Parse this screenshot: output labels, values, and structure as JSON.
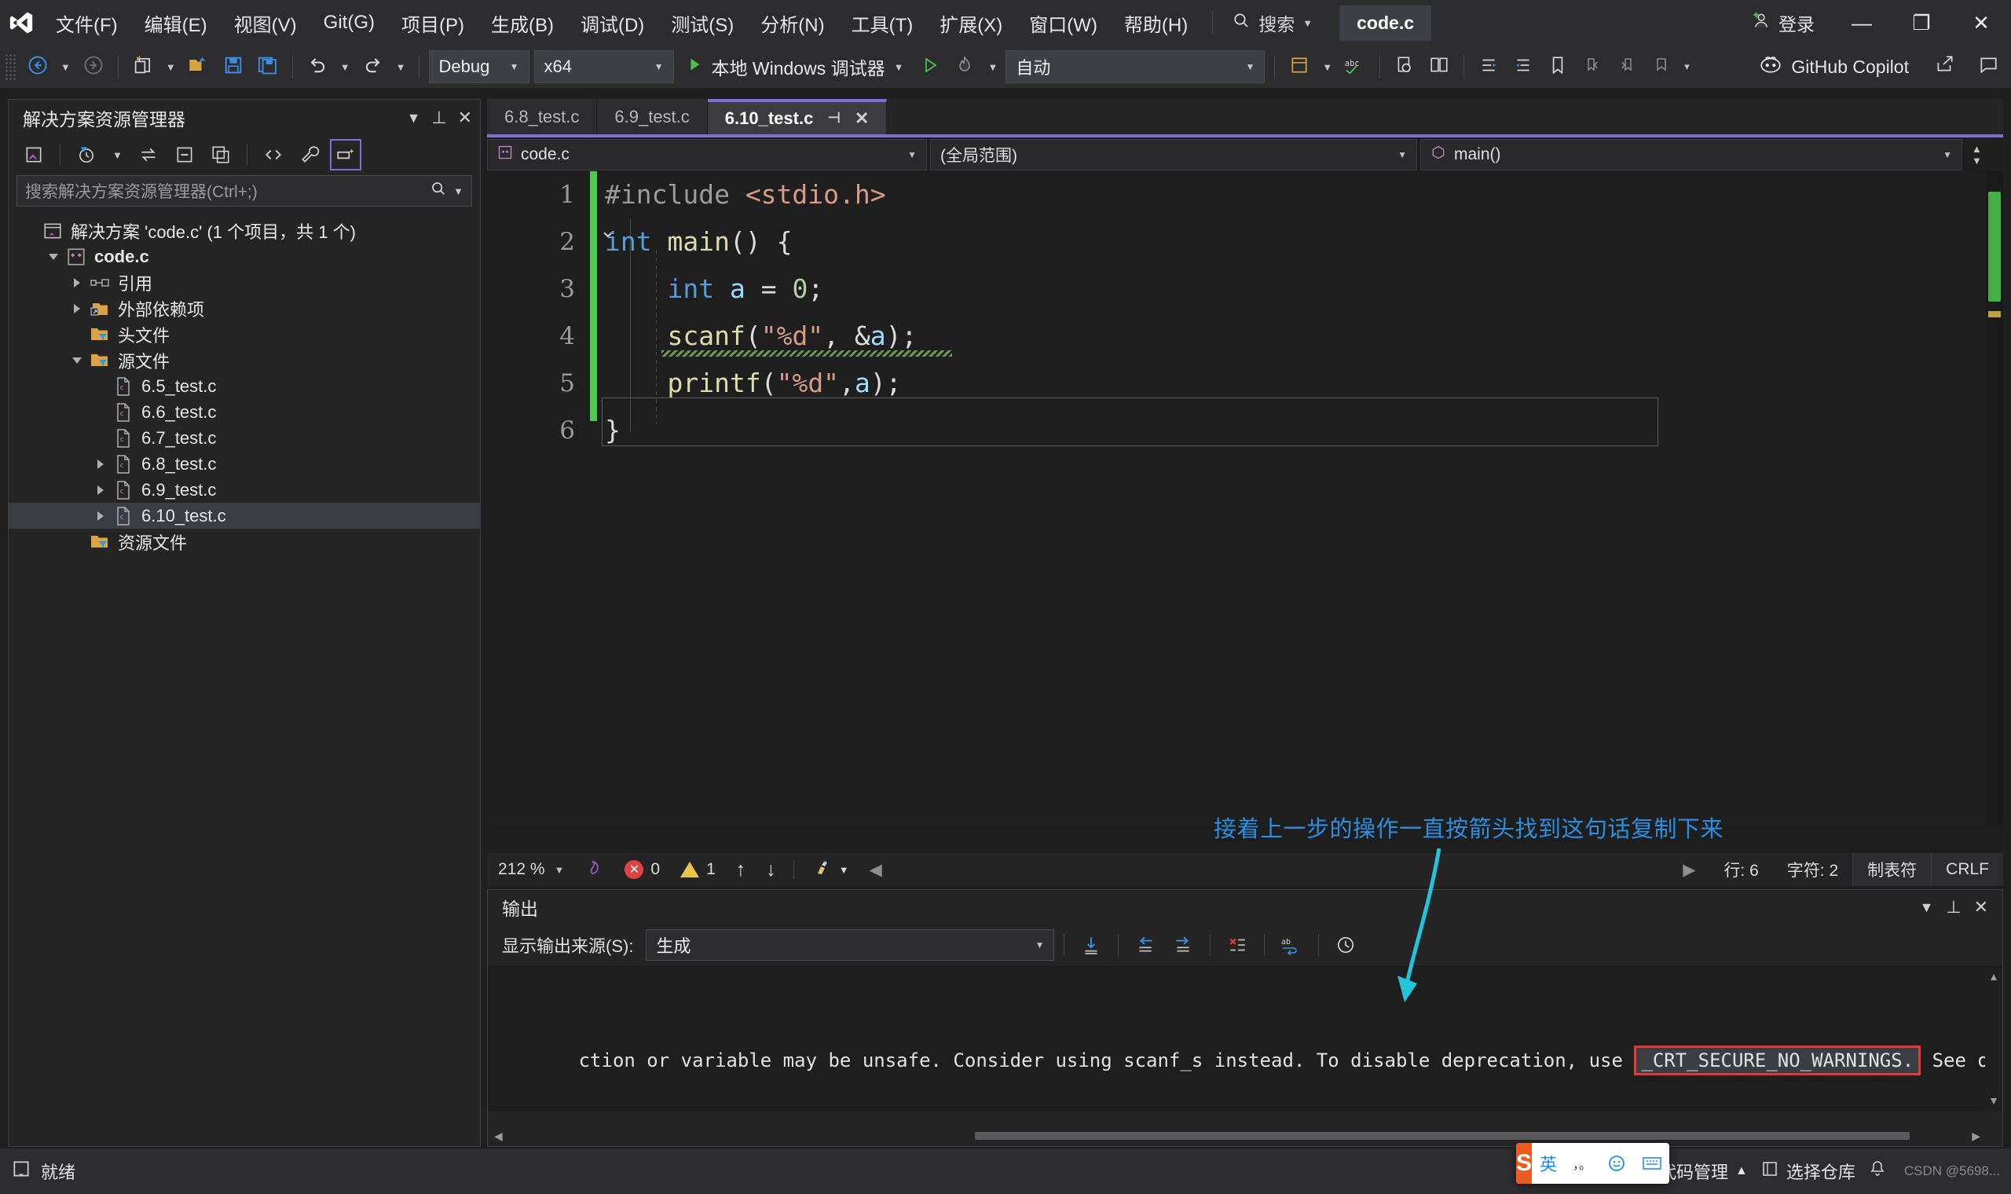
{
  "titlebar": {
    "logo_icon": "visual-studio-logo-icon",
    "menus": [
      {
        "label": "文件(F)"
      },
      {
        "label": "编辑(E)"
      },
      {
        "label": "视图(V)"
      },
      {
        "label": "Git(G)"
      },
      {
        "label": "项目(P)"
      },
      {
        "label": "生成(B)"
      },
      {
        "label": "调试(D)"
      },
      {
        "label": "测试(S)"
      },
      {
        "label": "分析(N)"
      },
      {
        "label": "工具(T)"
      },
      {
        "label": "扩展(X)"
      },
      {
        "label": "窗口(W)"
      },
      {
        "label": "帮助(H)"
      }
    ],
    "search_label": "搜索",
    "document_title": "code.c",
    "signin_label": "登录",
    "minimize_glyph": "—",
    "maximize_glyph": "❐",
    "close_glyph": "✕"
  },
  "toolbar": {
    "back_icon": "navigate-back-icon",
    "forward_icon": "navigate-forward-icon",
    "new_project_icon": "new-project-icon",
    "open_icon": "open-folder-icon",
    "save_icon": "save-icon",
    "save_all_icon": "save-all-icon",
    "undo_icon": "undo-icon",
    "redo_icon": "redo-icon",
    "config_value": "Debug",
    "platform_value": "x64",
    "run_label": "本地 Windows 调试器",
    "run_icon": "play-green-icon",
    "start_no_debug_icon": "play-outline-icon",
    "hot_reload_icon": "hot-reload-icon",
    "auto_value": "自动",
    "copilot_label": "GitHub Copilot",
    "copilot_icon": "copilot-icon",
    "share_icon": "share-icon",
    "feedback_icon": "feedback-icon"
  },
  "solution_explorer": {
    "title": "解决方案资源管理器",
    "header_icons": [
      "chevron-down-icon",
      "pin-icon",
      "close-icon"
    ],
    "toolbar_icons": [
      "solution-home-icon",
      "pending-changes-filter-icon",
      "sync-with-active-document-icon",
      "collapse-all-icon",
      "show-all-files-icon",
      "view-code-icon",
      "properties-wrench-icon",
      "toggle-preview-icon"
    ],
    "search_placeholder": "搜索解决方案资源管理器(Ctrl+;)",
    "tree": [
      {
        "label": "解决方案 'code.c' (1 个项目，共 1 个)",
        "indent": 0,
        "twisty": "none",
        "icon": "solution-icon",
        "bold": false,
        "selected": false
      },
      {
        "label": "code.c",
        "indent": 1,
        "twisty": "open",
        "icon": "cpp-project-icon",
        "bold": true,
        "selected": false
      },
      {
        "label": "引用",
        "indent": 2,
        "twisty": "closed",
        "icon": "references-icon",
        "bold": false,
        "selected": false
      },
      {
        "label": "外部依赖项",
        "indent": 2,
        "twisty": "closed",
        "icon": "external-deps-icon",
        "bold": false,
        "selected": false
      },
      {
        "label": "头文件",
        "indent": 2,
        "twisty": "none",
        "icon": "filter-folder-icon",
        "bold": false,
        "selected": false
      },
      {
        "label": "源文件",
        "indent": 2,
        "twisty": "open",
        "icon": "filter-folder-icon",
        "bold": false,
        "selected": false
      },
      {
        "label": "6.5_test.c",
        "indent": 3,
        "twisty": "none",
        "icon": "c-file-icon",
        "bold": false,
        "selected": false
      },
      {
        "label": "6.6_test.c",
        "indent": 3,
        "twisty": "none",
        "icon": "c-file-icon",
        "bold": false,
        "selected": false
      },
      {
        "label": "6.7_test.c",
        "indent": 3,
        "twisty": "none",
        "icon": "c-file-icon",
        "bold": false,
        "selected": false
      },
      {
        "label": "6.8_test.c",
        "indent": 3,
        "twisty": "closed",
        "icon": "c-file-icon",
        "bold": false,
        "selected": false
      },
      {
        "label": "6.9_test.c",
        "indent": 3,
        "twisty": "closed",
        "icon": "c-file-icon",
        "bold": false,
        "selected": false
      },
      {
        "label": "6.10_test.c",
        "indent": 3,
        "twisty": "closed",
        "icon": "c-file-icon",
        "bold": false,
        "selected": true
      },
      {
        "label": "资源文件",
        "indent": 2,
        "twisty": "none",
        "icon": "filter-folder-icon",
        "bold": false,
        "selected": false
      }
    ]
  },
  "editor": {
    "tabs": [
      {
        "label": "6.8_test.c",
        "active": false
      },
      {
        "label": "6.9_test.c",
        "active": false
      },
      {
        "label": "6.10_test.c",
        "active": true
      }
    ],
    "tab_pin_glyph": "⊣",
    "tab_close_glyph": "✕",
    "navbar": {
      "project": "code.c",
      "scope": "(全局范围)",
      "member": "main()",
      "project_icon": "cpp-project-icon",
      "member_icon": "method-icon"
    },
    "line_numbers": [
      "1",
      "2",
      "3",
      "4",
      "5",
      "6"
    ],
    "code": [
      {
        "n": 1,
        "tokens": [
          {
            "t": "#include ",
            "c": "k-pre"
          },
          {
            "t": "<stdio.h>",
            "c": "k-inc"
          }
        ]
      },
      {
        "n": 2,
        "tokens": [
          {
            "t": "int ",
            "c": "k-type"
          },
          {
            "t": "main",
            "c": "k-fn"
          },
          {
            "t": "() {",
            "c": "k-plain"
          }
        ]
      },
      {
        "n": 3,
        "tokens": [
          {
            "t": "    int ",
            "c": "k-type"
          },
          {
            "t": "a",
            "c": "k-var"
          },
          {
            "t": " = ",
            "c": "k-plain"
          },
          {
            "t": "0",
            "c": "k-num"
          },
          {
            "t": ";",
            "c": "k-plain"
          }
        ]
      },
      {
        "n": 4,
        "tokens": [
          {
            "t": "    ",
            "c": "k-plain"
          },
          {
            "t": "scanf",
            "c": "k-fn"
          },
          {
            "t": "(",
            "c": "k-plain"
          },
          {
            "t": "\"%d\"",
            "c": "k-str"
          },
          {
            "t": ", &",
            "c": "k-plain"
          },
          {
            "t": "a",
            "c": "k-var"
          },
          {
            "t": ");",
            "c": "k-plain"
          }
        ]
      },
      {
        "n": 5,
        "tokens": [
          {
            "t": "    ",
            "c": "k-plain"
          },
          {
            "t": "printf",
            "c": "k-fn"
          },
          {
            "t": "(",
            "c": "k-plain"
          },
          {
            "t": "\"%d\"",
            "c": "k-str"
          },
          {
            "t": ",",
            "c": "k-plain"
          },
          {
            "t": "a",
            "c": "k-var"
          },
          {
            "t": ");",
            "c": "k-plain"
          }
        ]
      },
      {
        "n": 6,
        "tokens": [
          {
            "t": "}",
            "c": "k-plain"
          }
        ]
      }
    ],
    "status": {
      "zoom": "212 %",
      "intellicode_icon": "intellicode-icon",
      "error_count": "0",
      "warning_count": "1",
      "prev_issue_glyph": "↑",
      "next_issue_glyph": "↓",
      "cleanup_icon": "code-cleanup-icon",
      "collapse_glyph": "◀",
      "expand_glyph": "▶",
      "line_label": "行: 6",
      "char_label": "字符: 2",
      "indent_label": "制表符",
      "eol_label": "CRLF"
    }
  },
  "output": {
    "title": "输出",
    "header_icons": [
      "chevron-down-icon",
      "pin-icon",
      "close-icon"
    ],
    "source_label": "显示输出来源(S):",
    "source_value": "生成",
    "toolbar_icons": [
      "find-message-icon",
      "go-to-previous-icon",
      "go-to-next-icon",
      "clear-all-icon",
      "toggle-word-wrap-icon",
      "history-icon"
    ],
    "line_prefix": "ction or variable may be unsafe. Consider using scanf_s instead. To disable deprecation, use ",
    "line_highlight": "_CRT_SECURE_NO_WARNINGS.",
    "line_suffix": " See online help for details."
  },
  "annotation": {
    "text": "接着上一步的操作一直按箭头找到这句话复制下来",
    "color": "#2b8fe0",
    "arrow_color": "#22c4d8"
  },
  "statusbar": {
    "ready_icon": "ready-icon",
    "ready_label": "就绪",
    "source_control_label": "添加到源代码管理",
    "source_control_arrow": "▲",
    "repo_icon": "repository-icon",
    "repo_label": "选择仓库",
    "bell_icon": "notification-bell-icon",
    "watermark": "CSDN @5698..."
  },
  "ime": {
    "logo_text": "S",
    "mode_label": "英",
    "punct_label": "，。",
    "emoji_icon": "emoji-icon",
    "keyboard_icon": "keyboard-icon"
  }
}
